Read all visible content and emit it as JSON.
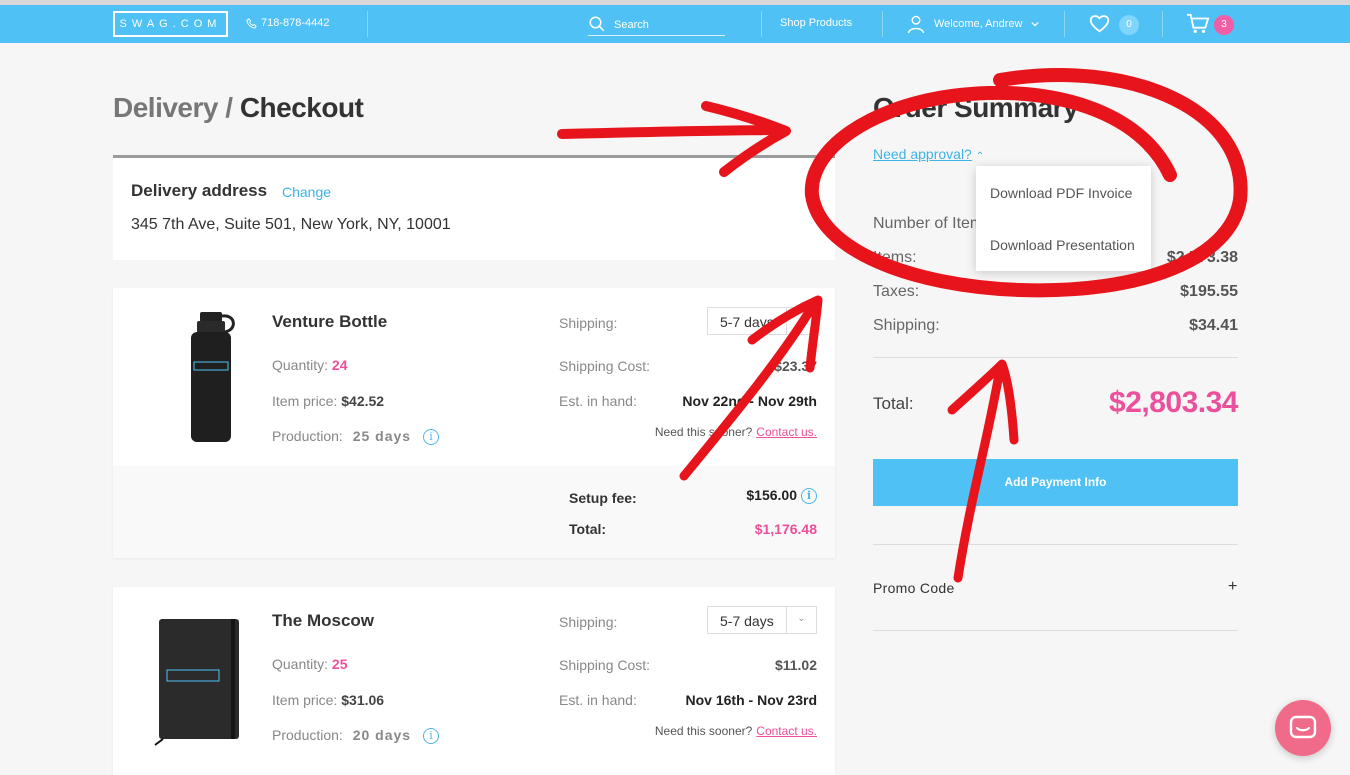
{
  "nav": {
    "logo": "SWAG.COM",
    "phone": "718-878-4442",
    "search_placeholder": "Search",
    "shop": "Shop Products",
    "welcome": "Welcome, Andrew",
    "favorites_count": "0",
    "cart_count": "3"
  },
  "page": {
    "title_part1": "Delivery /",
    "title_part2": "Checkout"
  },
  "delivery": {
    "label": "Delivery address",
    "change": "Change",
    "address": "345 7th Ave, Suite 501, New York, NY, 10001"
  },
  "products": [
    {
      "name": "Venture Bottle",
      "quantity_label": "Quantity:",
      "quantity": "24",
      "item_price_label": "Item price:",
      "item_price": "$42.52",
      "production_label": "Production:",
      "production": "25 days",
      "shipping_label": "Shipping:",
      "shipping_option": "5-7 days",
      "shipping_cost_label": "Shipping Cost:",
      "shipping_cost": "$23.37",
      "est_label": "Est. in hand:",
      "est_in_hand": "Nov 22nd - Nov 29th",
      "sooner": "Need this sooner?",
      "contact": "Contact us.",
      "setup_label": "Setup fee:",
      "setup_fee": "$156.00",
      "total_label": "Total:",
      "total": "$1,176.48"
    },
    {
      "name": "The Moscow",
      "quantity_label": "Quantity:",
      "quantity": "25",
      "item_price_label": "Item price:",
      "item_price": "$31.06",
      "production_label": "Production:",
      "production": "20 days",
      "shipping_label": "Shipping:",
      "shipping_option": "5-7 days",
      "shipping_cost_label": "Shipping Cost:",
      "shipping_cost": "$11.02",
      "est_label": "Est. in hand:",
      "est_in_hand": "Nov 16th - Nov 23rd",
      "sooner": "Need this sooner?",
      "contact": "Contact us."
    }
  ],
  "summary": {
    "title": "Order Summary",
    "need_approval": "Need approval?",
    "dropdown": [
      "Download PDF Invoice",
      "Download Presentation"
    ],
    "number_of_items_label": "Number of Items:",
    "items_label": "Items:",
    "items_value": "$2,573.38",
    "taxes_label": "Taxes:",
    "taxes_value": "$195.55",
    "shipping_label": "Shipping:",
    "shipping_value": "$34.41",
    "total_label": "Total:",
    "total_value": "$2,803.34",
    "pay_button": "Add Payment Info",
    "promo": "Promo Code",
    "promo_plus": "+"
  },
  "colors": {
    "nav": "#4fc1f5",
    "pink": "#ec4f9b",
    "link": "#3fb2e6",
    "annotation": "#e8141b"
  }
}
